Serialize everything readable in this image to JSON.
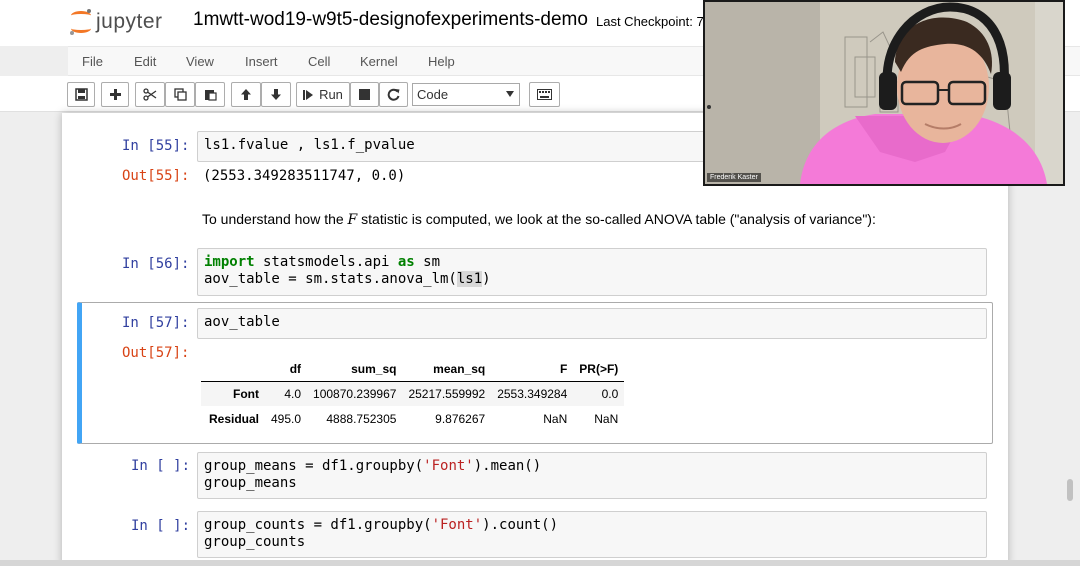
{
  "app": {
    "logo_text": "jupyter",
    "notebook_title": "1mwtt-wod19-w9t5-designofexperiments-demo",
    "checkpoint": "Last Checkpoint: 7"
  },
  "menu": [
    "File",
    "Edit",
    "View",
    "Insert",
    "Cell",
    "Kernel",
    "Help"
  ],
  "toolbar": {
    "run_label": "Run",
    "cell_type": "Code",
    "icons": [
      "save-icon",
      "add-cell-icon",
      "cut-icon",
      "copy-icon",
      "paste-icon",
      "move-up-icon",
      "move-down-icon",
      "run-icon",
      "stop-icon",
      "restart-icon",
      "keyboard-icon"
    ]
  },
  "cells": {
    "c55": {
      "in_prompt": "In [55]:",
      "code": "ls1.fvalue , ls1.f_pvalue",
      "out_prompt": "Out[55]:",
      "output": "(2553.349283511747, 0.0)"
    },
    "md": {
      "before": "To understand how the ",
      "symbol": "F",
      "after": " statistic is computed, we look at the so-called ANOVA table (\"analysis of variance\"):"
    },
    "c56": {
      "in_prompt": "In [56]:",
      "line1_kw1": "import",
      "line1_mod": " statsmodels.api ",
      "line1_kw2": "as",
      "line1_alias": " sm",
      "line2_pre": "aov_table = sm.stats.anova_lm(",
      "line2_hl": "ls1",
      "line2_post": ")"
    },
    "c57": {
      "in_prompt": "In [57]:",
      "code": "aov_table",
      "out_prompt": "Out[57]:",
      "table": {
        "columns": [
          "",
          "df",
          "sum_sq",
          "mean_sq",
          "F",
          "PR(>F)"
        ],
        "rows": [
          {
            "index": "Font",
            "df": "4.0",
            "sum_sq": "100870.239967",
            "mean_sq": "25217.559992",
            "F": "2553.349284",
            "PR": "0.0"
          },
          {
            "index": "Residual",
            "df": "495.0",
            "sum_sq": "4888.752305",
            "mean_sq": "9.876267",
            "F": "NaN",
            "PR": "NaN"
          }
        ]
      }
    },
    "c58": {
      "in_prompt": "In [ ]:",
      "l1_pre": "group_means = df1.groupby(",
      "l1_str": "'Font'",
      "l1_post": ").mean()",
      "l2": "group_means"
    },
    "c59": {
      "in_prompt": "In [ ]:",
      "l1_pre": "group_counts = df1.groupby(",
      "l1_str": "'Font'",
      "l1_post": ").count()",
      "l2": "group_counts"
    }
  },
  "webcam": {
    "name": "Frederik Kaster"
  },
  "colors": {
    "in_prompt": "#303f9f",
    "out_prompt": "#d84315",
    "selected_border": "#42a5f5",
    "keyword": "#008000",
    "string": "#ba2121",
    "logo_orange": "#f37726"
  }
}
